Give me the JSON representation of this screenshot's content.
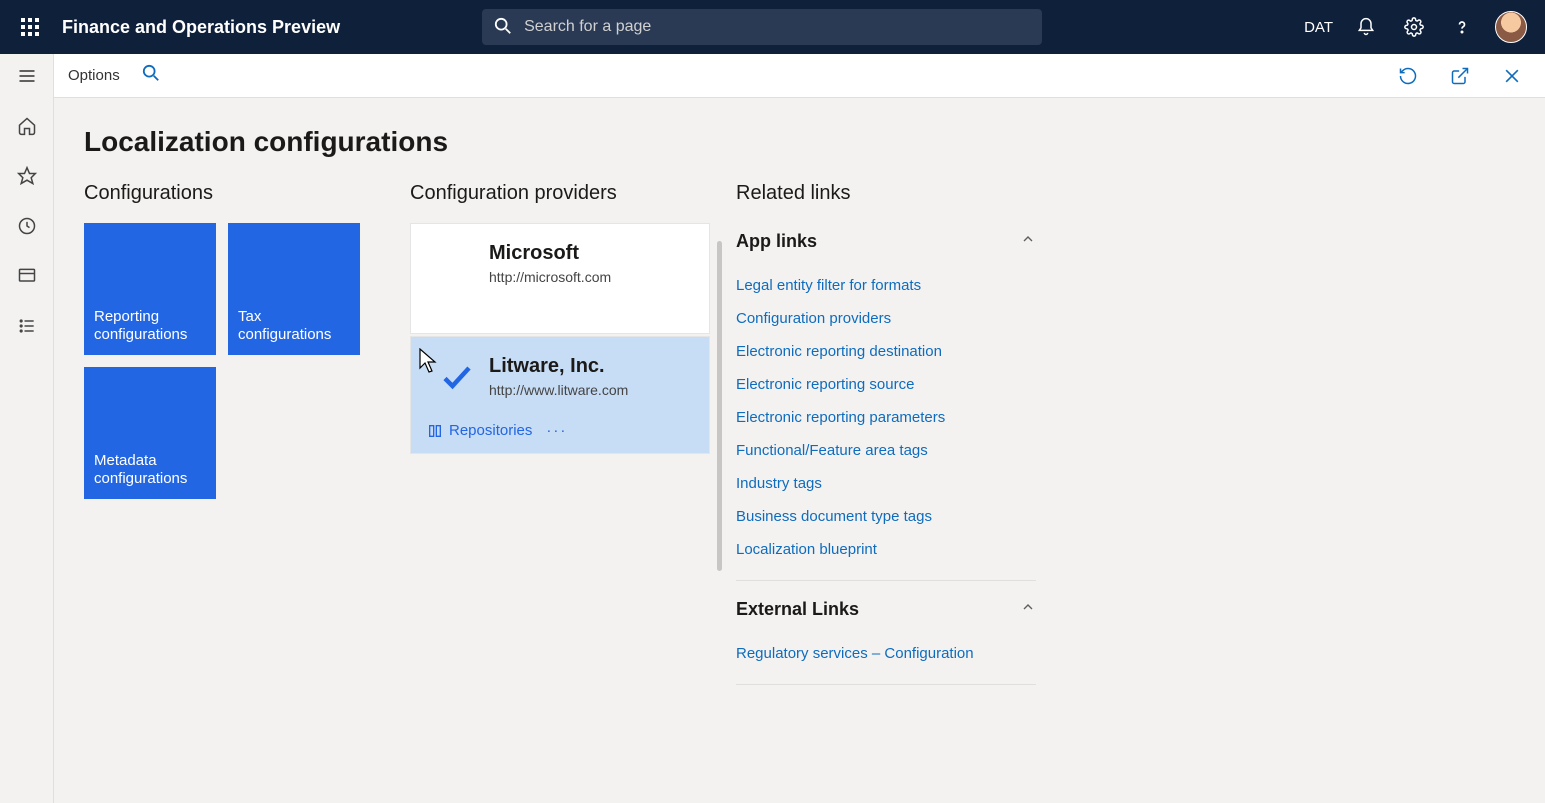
{
  "header": {
    "app_title": "Finance and Operations Preview",
    "search_placeholder": "Search for a page",
    "entity": "DAT"
  },
  "subbar": {
    "options_label": "Options"
  },
  "page": {
    "title": "Localization configurations",
    "col_configurations": "Configurations",
    "col_providers": "Configuration providers",
    "col_related": "Related links"
  },
  "tiles": [
    {
      "label": "Reporting configurations"
    },
    {
      "label": "Tax configurations"
    },
    {
      "label": "Metadata configurations"
    }
  ],
  "providers": [
    {
      "name": "Microsoft",
      "url": "http://microsoft.com",
      "active": false
    },
    {
      "name": "Litware, Inc.",
      "url": "http://www.litware.com",
      "active": true
    }
  ],
  "provider_actions": {
    "repositories": "Repositories",
    "more": "···"
  },
  "related": {
    "app_links": {
      "title": "App links",
      "items": [
        "Legal entity filter for formats",
        "Configuration providers",
        "Electronic reporting destination",
        "Electronic reporting source",
        "Electronic reporting parameters",
        "Functional/Feature area tags",
        "Industry tags",
        "Business document type tags",
        "Localization blueprint"
      ]
    },
    "external_links": {
      "title": "External Links",
      "items": [
        "Regulatory services – Configuration"
      ]
    }
  }
}
